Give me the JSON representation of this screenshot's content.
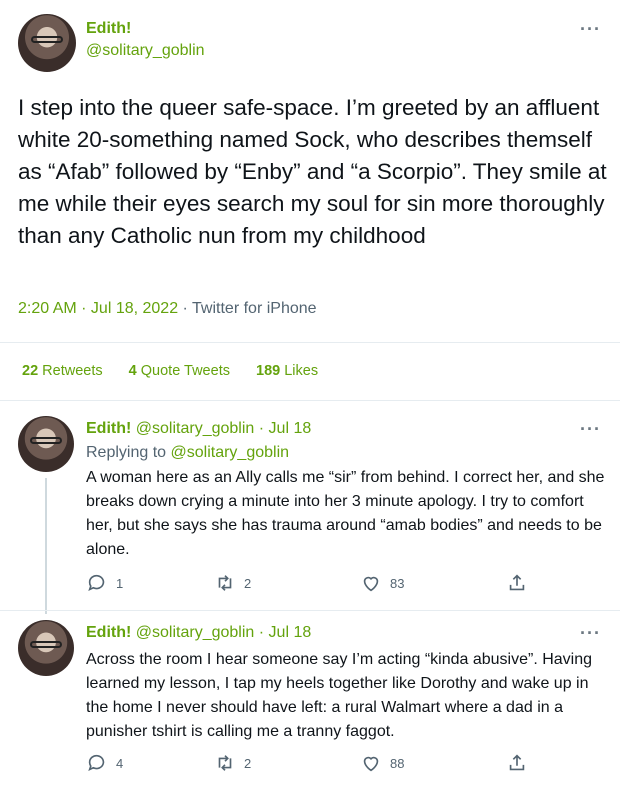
{
  "main_tweet": {
    "author_name": "Edith!",
    "author_handle": "@solitary_goblin",
    "text": "I step into the queer safe-space. I’m greeted by an affluent white 20-something named Sock, who describes themself as “Afab” followed by “Enby” and “a Scorpio”. They smile at me while their eyes search my soul for sin more thoroughly than any Catholic nun from my childhood",
    "time": "2:20 AM · Jul 18, 2022",
    "source": " · Twitter for iPhone",
    "more_icon": "···"
  },
  "stats": {
    "retweets_count": "22",
    "retweets_label": "Retweets",
    "quotes_count": "4",
    "quotes_label": "Quote Tweets",
    "likes_count": "189",
    "likes_label": "Likes"
  },
  "replies": [
    {
      "author_name": "Edith!",
      "author_handle": "@solitary_goblin",
      "date": "· Jul 18",
      "replying_label": "Replying to",
      "replying_handle": "@solitary_goblin",
      "text": "A woman here as an Ally calls me “sir” from behind. I correct her, and she breaks down crying a minute into her 3 minute apology. I try to comfort her, but she says she has trauma around “amab bodies” and needs to be alone.",
      "reply_count": "1",
      "retweet_count": "2",
      "like_count": "83",
      "more_icon": "···"
    },
    {
      "author_name": "Edith!",
      "author_handle": "@solitary_goblin",
      "date": "· Jul 18",
      "text": "Across the room I hear someone say I’m acting “kinda abusive”. Having learned my lesson, I tap my heels together like Dorothy and wake up in the home I never should have left: a rural Walmart where a dad in a punisher tshirt is calling me a tranny faggot.",
      "reply_count": "4",
      "retweet_count": "2",
      "like_count": "88",
      "more_icon": "···"
    }
  ],
  "colors": {
    "accent": "#64a30d",
    "text": "#0f1419",
    "muted": "#536471",
    "divider": "#e6ecf0"
  },
  "icons": [
    "reply-icon",
    "retweet-icon",
    "like-icon",
    "share-icon",
    "more-icon"
  ]
}
